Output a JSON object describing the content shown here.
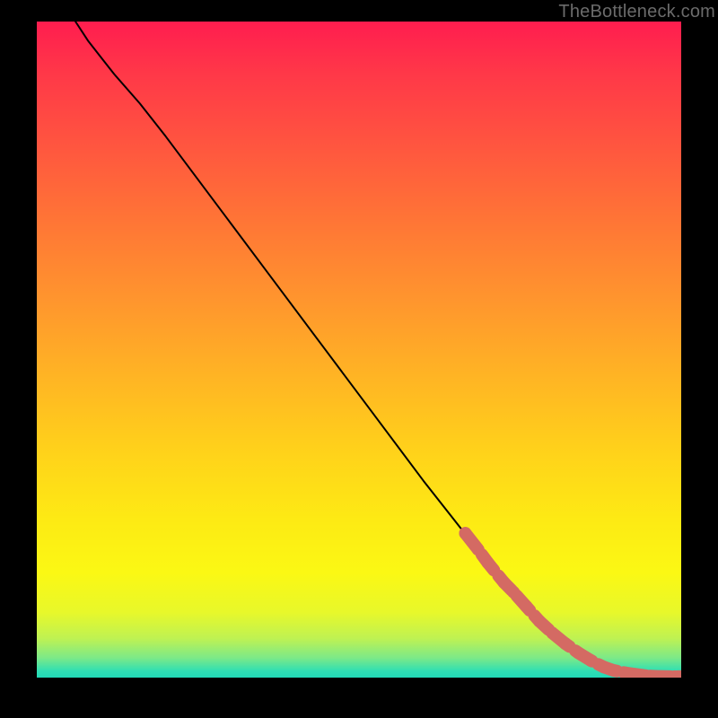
{
  "attribution": "TheBottleneck.com",
  "chart_data": {
    "type": "line",
    "title": "",
    "xlabel": "",
    "ylabel": "",
    "xlim": [
      0,
      100
    ],
    "ylim": [
      0,
      100
    ],
    "grid": false,
    "series": [
      {
        "name": "curve",
        "style": "line",
        "color": "#000000",
        "x": [
          6,
          8,
          10,
          12,
          16,
          20,
          28,
          36,
          44,
          52,
          60,
          68,
          72,
          76,
          80,
          84,
          88,
          90,
          92,
          94,
          96,
          98,
          100
        ],
        "y": [
          100,
          97,
          94.5,
          92,
          87.5,
          82.5,
          72,
          61.5,
          51,
          40.5,
          30,
          20,
          15.2,
          10.8,
          6.8,
          3.8,
          1.6,
          0.9,
          0.5,
          0.3,
          0.2,
          0.15,
          0.15
        ]
      },
      {
        "name": "markers",
        "style": "points",
        "color": "#d46a63",
        "x": [
          66.5,
          68.5,
          70,
          72.5,
          74,
          76,
          78,
          80,
          82,
          84,
          86,
          88,
          89.5,
          91.5,
          94.5,
          96,
          99,
          100
        ],
        "y": [
          22,
          19.5,
          17.5,
          14.5,
          13,
          10.8,
          8.6,
          6.8,
          5.2,
          3.8,
          2.6,
          1.6,
          1.1,
          0.7,
          0.3,
          0.2,
          0.15,
          0.15
        ]
      }
    ]
  }
}
